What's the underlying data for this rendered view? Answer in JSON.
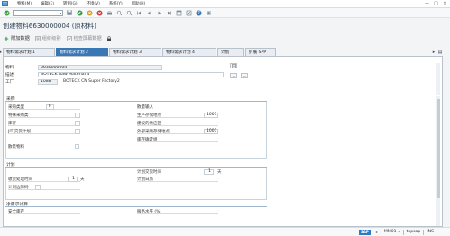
{
  "menubar": {
    "items": [
      "物料(M)",
      "编辑(E)",
      "转到(G)",
      "环境(V)",
      "系统(Y)",
      "帮助(H)"
    ],
    "window_buttons": [
      "—",
      "□",
      "✕"
    ]
  },
  "title": "创建物料6630000004 (原材料)",
  "app_toolbar": {
    "additional_data": "附加数据",
    "org_levels": "组织级别",
    "check_screen_data": "检查屏幕数据"
  },
  "tabs": [
    "物料需求计划 1",
    "物料需求计划 2",
    "物料需求计划 3",
    "物料需求计划 4",
    "计划",
    "扩展 SPP"
  ],
  "active_tab_index": 1,
  "header": {
    "material_label": "物料",
    "material_value": "6630000004",
    "desc_label": "描述",
    "desc_value": "BOTECK Raw Material 4",
    "plant_label": "工厂",
    "plant_value": "1088",
    "plant_name": "BOTECK CN Super Factory2"
  },
  "procurement": {
    "title": "采购",
    "proc_type_label": "采购类型",
    "proc_type_value": "F",
    "special_proc_label": "特殊采购类",
    "quota_label": "库存",
    "jit_label": "JIT 交货计划",
    "bulk_label": "散量输入",
    "prod_storage_label": "生产存储地点",
    "prod_storage_value": "1001",
    "supply_area_label": "建议的供应区",
    "ext_storage_label": "外部采购存储地点",
    "ext_storage_value": "1001",
    "stock_det_label": "库存确定组",
    "batch_label": "散装物料"
  },
  "scheduling": {
    "title": "计划",
    "planned_del_label": "计划交货时间",
    "planned_del_value": "1",
    "planned_del_unit": "天",
    "gr_time_label": "收货处理时间",
    "gr_time_value": "1",
    "gr_time_unit": "天",
    "calendar_label": "计划日历",
    "margin_key_label": "计划边际码"
  },
  "net_req": {
    "title": "净需求计算",
    "safety_stock_label": "安全库存",
    "service_level_label": "服务水平 (%)"
  },
  "statusbar": {
    "sap": "SAP",
    "session": "MM01",
    "server": "topsap",
    "mode": "INS"
  }
}
